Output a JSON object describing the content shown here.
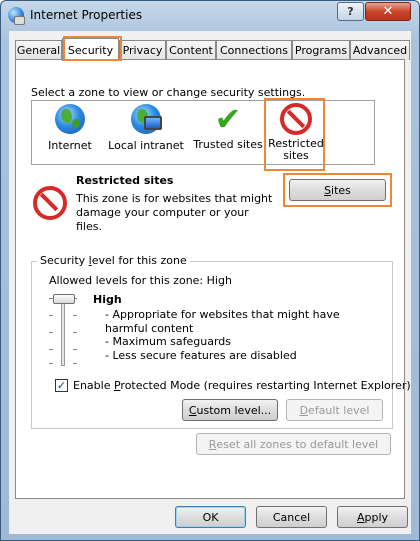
{
  "window": {
    "title": "Internet Properties",
    "help": "?",
    "close": "✕"
  },
  "tabs": [
    {
      "label": "General"
    },
    {
      "label": "Security"
    },
    {
      "label": "Privacy"
    },
    {
      "label": "Content"
    },
    {
      "label": "Connections"
    },
    {
      "label": "Programs"
    },
    {
      "label": "Advanced"
    }
  ],
  "security": {
    "intro": "Select a zone to view or change security settings.",
    "zones": [
      {
        "label": "Internet",
        "icon": "globe-icon"
      },
      {
        "label": "Local intranet",
        "icon": "intranet-icon"
      },
      {
        "label": "Trusted sites",
        "icon": "checkmark-icon"
      },
      {
        "label": "Restricted sites",
        "icon": "restricted-icon"
      }
    ],
    "zone_title": "Restricted sites",
    "zone_desc": "This zone is for websites that might damage your computer or your files.",
    "sites_button_prefix": "",
    "sites_button_mnemonic": "S",
    "sites_button_rest": "ites",
    "level_legend_prefix": "Security ",
    "level_legend_mnemonic": "l",
    "level_legend_rest": "evel for this zone",
    "allowed": "Allowed levels for this zone: High",
    "level_name": "High",
    "level_items": [
      "- Appropriate for websites that might have harmful content",
      "- Maximum safeguards",
      "- Less secure features are disabled"
    ],
    "protected_mode_prefix": "Enable ",
    "protected_mode_mnemonic": "P",
    "protected_mode_rest": "rotected Mode (requires restarting Internet Explorer)",
    "protected_mode_checked": "✓",
    "custom_prefix": "",
    "custom_mnemonic": "C",
    "custom_rest": "ustom level...",
    "default_prefix": "",
    "default_mnemonic": "D",
    "default_rest": "efault level",
    "reset_prefix": "",
    "reset_mnemonic": "R",
    "reset_rest": "eset all zones to default level"
  },
  "footer": {
    "ok": "OK",
    "cancel": "Cancel",
    "apply_mnemonic": "A",
    "apply_rest": "pply"
  },
  "colors": {
    "highlight": "#f0863a",
    "restricted": "#d62a2a",
    "trusted": "#34a51c"
  }
}
